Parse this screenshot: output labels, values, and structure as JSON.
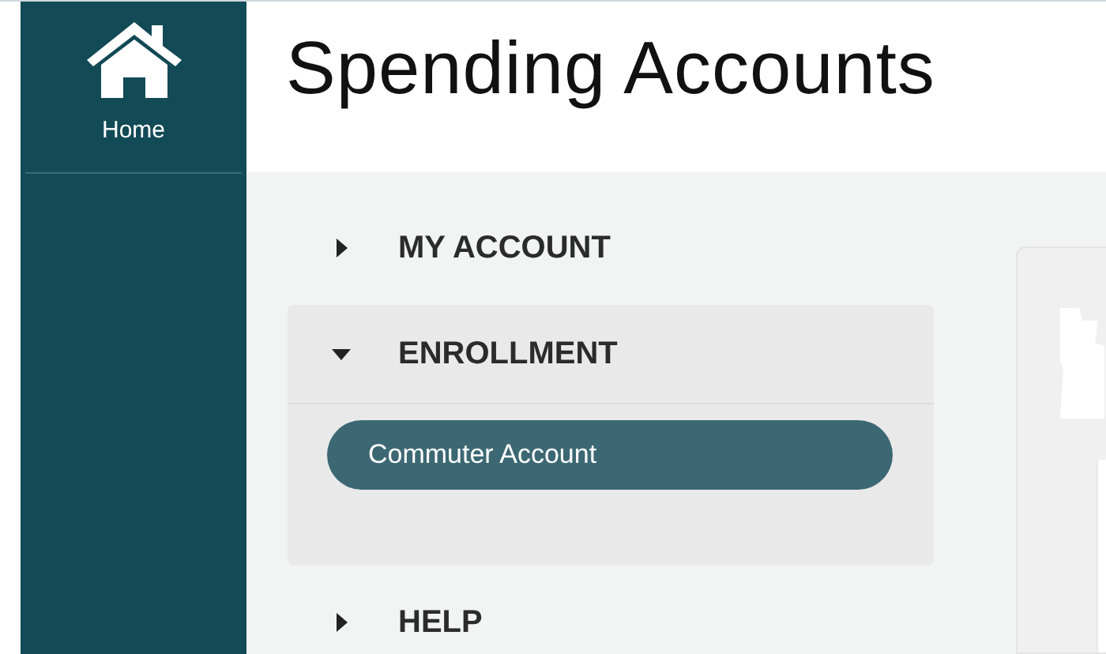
{
  "sidebar": {
    "items": [
      {
        "label": "Home",
        "kind": "home"
      }
    ]
  },
  "header": {
    "title": "Spending Accounts"
  },
  "menu": [
    {
      "label": "MY ACCOUNT",
      "expanded": false
    },
    {
      "label": "ENROLLMENT",
      "expanded": true,
      "children": [
        {
          "label": "Commuter Account",
          "selected": true
        }
      ]
    },
    {
      "label": "HELP",
      "expanded": false
    }
  ]
}
